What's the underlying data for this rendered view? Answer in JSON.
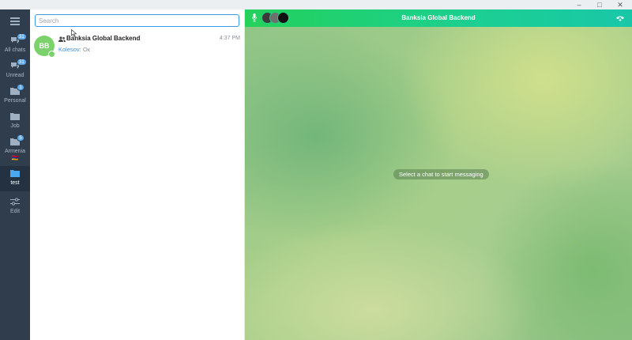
{
  "window": {
    "minimize_glyph": "–",
    "maximize_glyph": "□",
    "close_glyph": "✕"
  },
  "sidebar": {
    "folders": [
      {
        "label": "All chats",
        "badge": "31",
        "icon": "chats-icon"
      },
      {
        "label": "Unread",
        "badge": "31",
        "icon": "chats-icon"
      },
      {
        "label": "Personal",
        "badge": "1",
        "icon": "folder-icon"
      },
      {
        "label": "Job",
        "badge": "",
        "icon": "folder-icon"
      },
      {
        "label": "Armenia",
        "badge": "5",
        "icon": "folder-icon",
        "emoji": "🇦🇲"
      },
      {
        "label": "test",
        "badge": "",
        "icon": "folder-icon",
        "active": true
      },
      {
        "label": "Edit",
        "badge": "",
        "icon": "sliders-icon"
      }
    ]
  },
  "search": {
    "placeholder": "Search"
  },
  "chats": [
    {
      "avatar_initials": "BB",
      "name": "Banksia Global Backend",
      "time": "4:37 PM",
      "sender": "Kolesov:",
      "text": "Ок"
    }
  ],
  "call_bar": {
    "title": "Banksia Global Backend"
  },
  "main": {
    "empty_message": "Select a chat to start messaging"
  },
  "colors": {
    "sidebar_bg": "#2f3d4d",
    "accent": "#3c9be0",
    "call_bar": "#24d15b",
    "avatar": "#7bd26b"
  }
}
